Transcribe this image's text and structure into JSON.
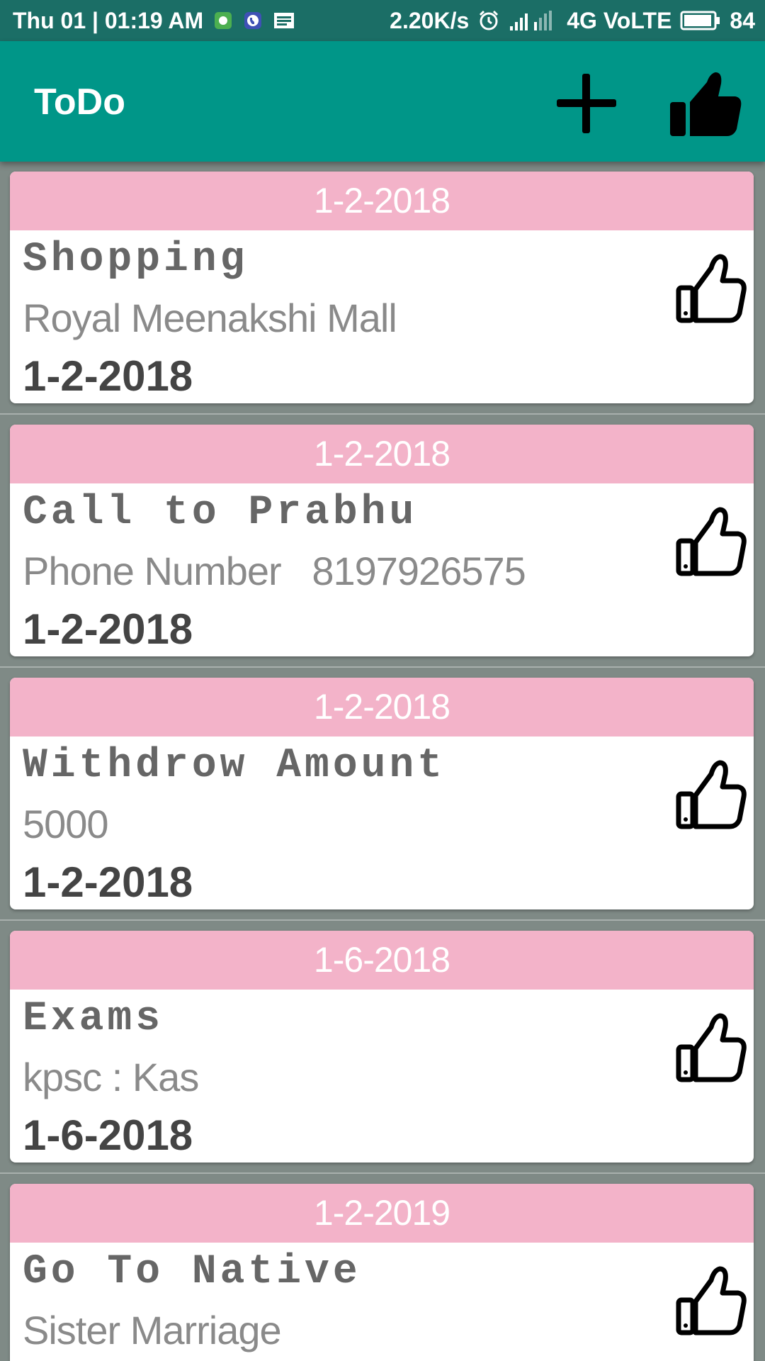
{
  "status_bar": {
    "datetime": "Thu 01 | 01:19 AM",
    "net_speed": "2.20K/s",
    "network": "4G VoLTE",
    "battery": "84"
  },
  "app_bar": {
    "title": "ToDo",
    "add_icon": "plus-icon",
    "like_icon": "thumbs-up-filled-icon"
  },
  "todos": [
    {
      "header_date": "1-2-2018",
      "title": "Shopping",
      "description": "Royal Meenakshi Mall",
      "date": "1-2-2018"
    },
    {
      "header_date": "1-2-2018",
      "title": "Call to Prabhu",
      "description": "Phone Number   8197926575",
      "date": "1-2-2018"
    },
    {
      "header_date": "1-2-2018",
      "title": "Withdrow Amount",
      "description": "5000",
      "date": "1-2-2018"
    },
    {
      "header_date": "1-6-2018",
      "title": "Exams",
      "description": "kpsc : Kas",
      "date": "1-6-2018"
    },
    {
      "header_date": "1-2-2019",
      "title": "Go To Native",
      "description": "Sister Marriage",
      "date": ""
    }
  ],
  "colors": {
    "primary": "#009688",
    "status_bar": "#1b6e66",
    "card_header": "#f3b3c9",
    "background": "#7f8a86"
  }
}
